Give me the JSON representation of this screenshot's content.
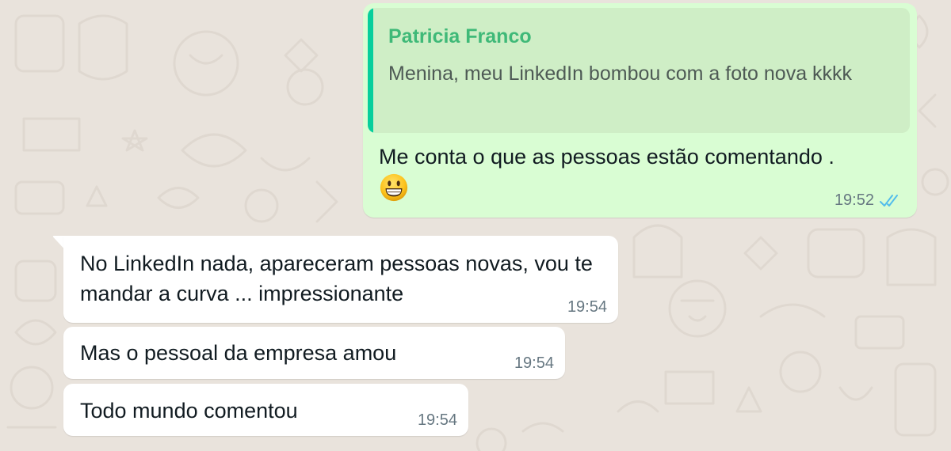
{
  "colors": {
    "outgoing_bubble": "#d9fdd3",
    "incoming_bubble": "#ffffff",
    "quote_bar": "#06cf9c",
    "quote_author": "#3fb978",
    "read_ticks": "#53bdeb"
  },
  "outgoing": {
    "quote": {
      "author": "Patricia Franco",
      "text": "Menina, meu LinkedIn bombou com a foto nova kkkk"
    },
    "text": "Me conta o que as pessoas estão comentando .",
    "emoji": "grinning-face-emoji",
    "time": "19:52",
    "status_icon": "double-check-read-icon"
  },
  "incoming": [
    {
      "text": "No LinkedIn nada, apareceram pessoas novas, vou te mandar a curva ... impressionante",
      "time": "19:54"
    },
    {
      "text": "Mas o pessoal da empresa amou",
      "time": "19:54"
    },
    {
      "text": "Todo mundo comentou",
      "time": "19:54"
    }
  ]
}
